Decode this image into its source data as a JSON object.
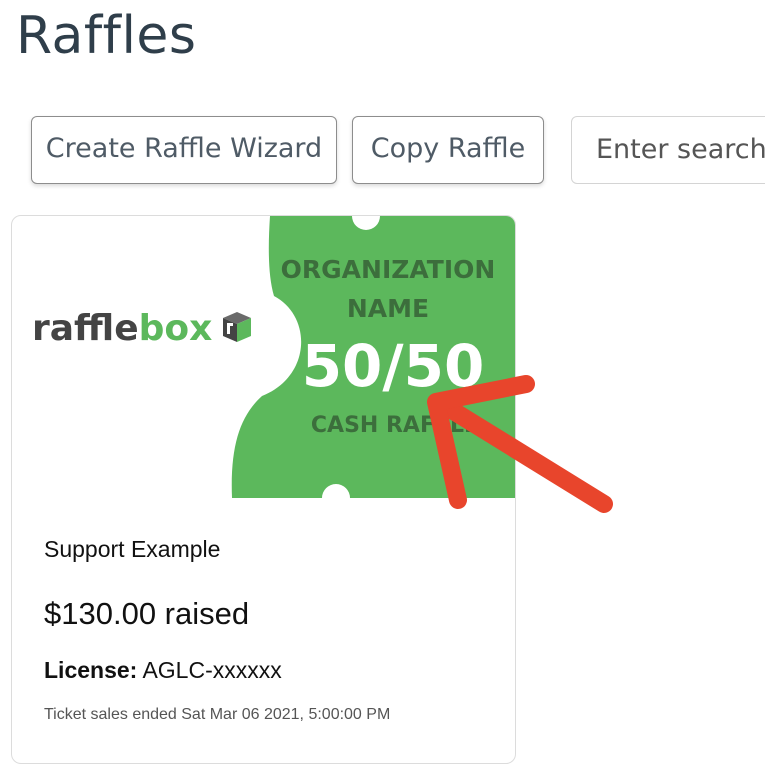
{
  "header": {
    "title": "Raffles"
  },
  "toolbar": {
    "wizard_label": "Create Raffle Wizard",
    "copy_label": "Copy Raffle",
    "search_placeholder": "Enter search"
  },
  "card": {
    "logo_text_dark": "raffle",
    "logo_text_green": "box",
    "ticket": {
      "line1": "ORGANIZATION",
      "line2": "NAME",
      "big": "50/50",
      "line4": "CASH RAFFLE"
    },
    "name": "Support Example",
    "raised": "$130.00 raised",
    "license_label": "License:",
    "license_value": "AGLC-xxxxxx",
    "ended_text": "Ticket sales ended Sat Mar 06 2021, 5:00:00 PM"
  },
  "colors": {
    "ticket_green": "#5cb85c",
    "logo_dark": "#444444",
    "logo_green": "#5cb85c",
    "arrow_red": "#e8452c"
  },
  "icons": {
    "logo": "rafflebox-cube-icon",
    "annotation": "red-arrow-annotation"
  }
}
